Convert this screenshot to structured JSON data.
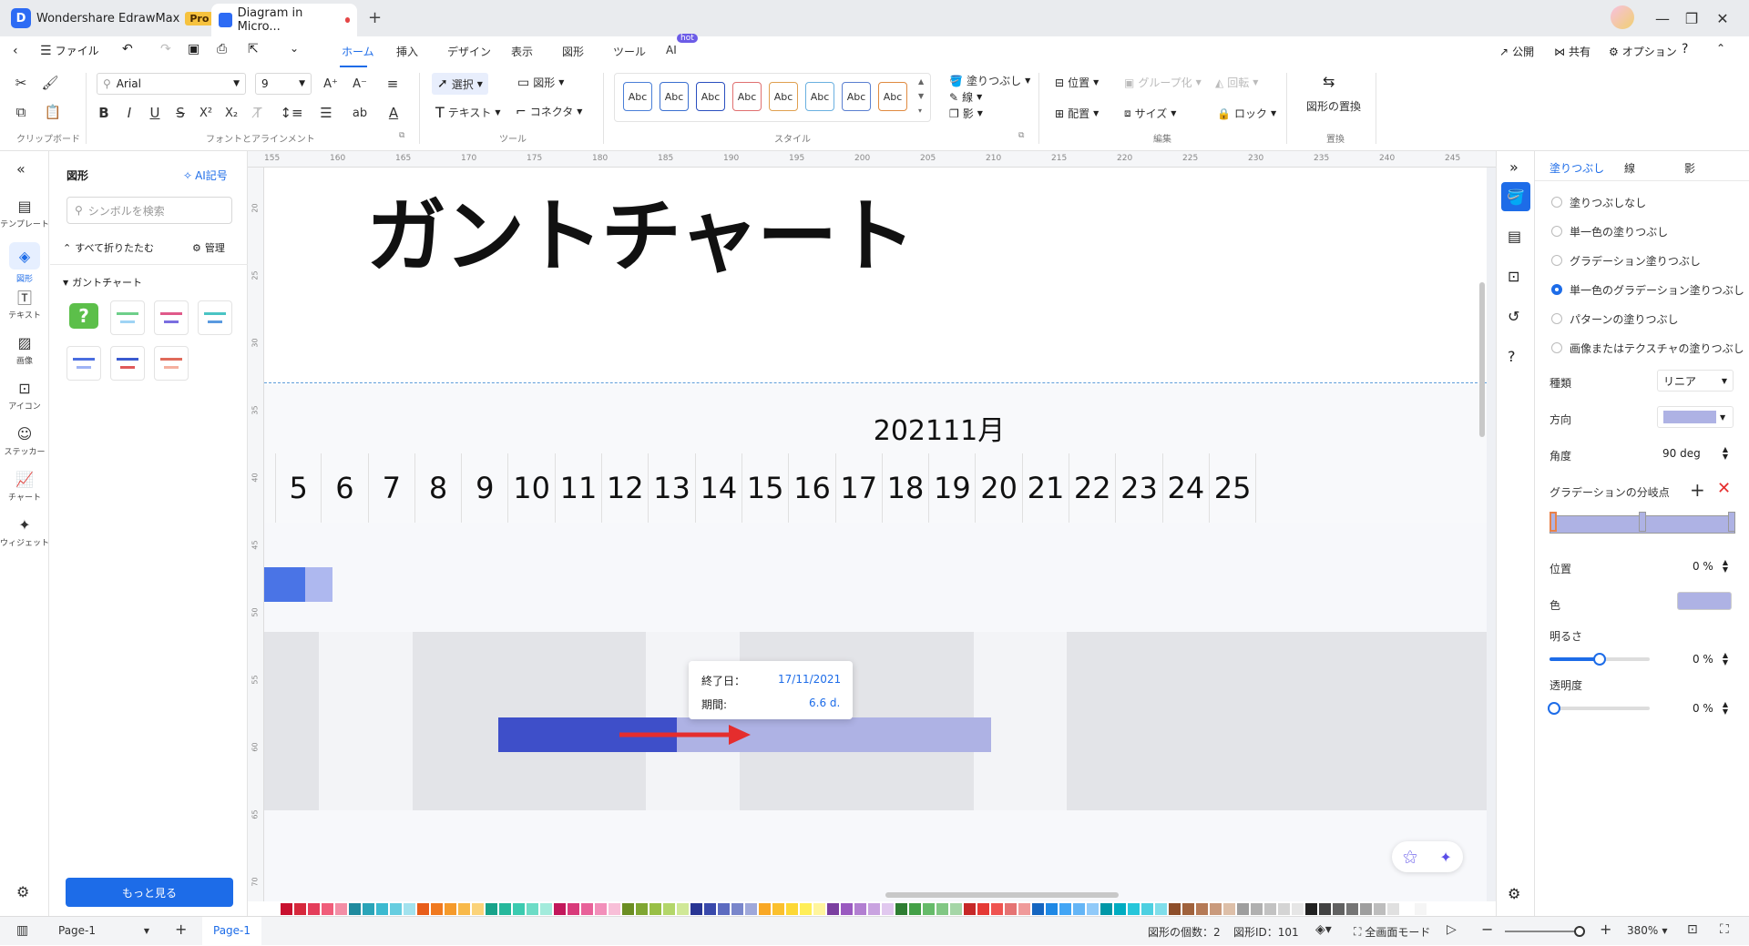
{
  "app": {
    "name": "Wondershare EdrawMax",
    "badge": "Pro",
    "doc_tab": "Diagram in Micro..."
  },
  "menu": {
    "file": "ファイル",
    "tabs": [
      "ホーム",
      "挿入",
      "デザイン",
      "表示",
      "図形",
      "ツール",
      "AI"
    ],
    "hot": "hot",
    "active": "ホーム",
    "right": [
      "公開",
      "共有",
      "オプション"
    ]
  },
  "ribbon": {
    "font": "Arial",
    "size": "9",
    "select": "選択",
    "shape": "図形",
    "text": "テキスト",
    "connector": "コネクタ",
    "fill": "塗りつぶし",
    "line": "線",
    "shadow": "影",
    "position": "位置",
    "align": "配置",
    "size_label": "サイズ",
    "group": "グループ化",
    "rotate": "回転",
    "lock": "ロック",
    "replace": "図形の置換",
    "style_sample": "Abc",
    "groups": [
      "クリップボード",
      "フォントとアラインメント",
      "ツール",
      "スタイル",
      "編集",
      "置換"
    ]
  },
  "leftbar": [
    "テンプレート",
    "図形",
    "テキスト",
    "画像",
    "アイコン",
    "ステッカー",
    "チャート",
    "ウィジェット"
  ],
  "shape_panel": {
    "title": "図形",
    "ai": "AI記号",
    "search_placeholder": "シンボルを検索",
    "collapse": "すべて折りたたむ",
    "manage": "管理",
    "category": "ガントチャート",
    "more": "もっと見る"
  },
  "ruler_top": [
    "155",
    "160",
    "165",
    "170",
    "175",
    "180",
    "185",
    "190",
    "195",
    "200",
    "205",
    "210",
    "215",
    "220",
    "225",
    "230",
    "235",
    "240",
    "245"
  ],
  "ruler_left": [
    "20",
    "25",
    "30",
    "35",
    "40",
    "45",
    "50",
    "55",
    "60",
    "65",
    "70"
  ],
  "chart_data": {
    "type": "table",
    "title": "ガントチャート",
    "month": "202111月",
    "days": [
      "5",
      "6",
      "7",
      "8",
      "9",
      "10",
      "11",
      "12",
      "13",
      "14",
      "15",
      "16",
      "17",
      "18",
      "19",
      "20",
      "21",
      "22",
      "23",
      "24",
      "25"
    ],
    "tooltip": {
      "end_label": "終了日：",
      "end_value": "17/11/2021",
      "duration_label": "期間:",
      "duration_value": "6.6 d."
    }
  },
  "right_panel": {
    "tabs": [
      "塗りつぶし",
      "線",
      "影"
    ],
    "options": [
      "塗りつぶしなし",
      "単一色の塗りつぶし",
      "グラデーション塗りつぶし",
      "単一色のグラデーション塗りつぶし",
      "パターンの塗りつぶし",
      "画像またはテクスチャの塗りつぶし"
    ],
    "selected_option": "単一色のグラデーション塗りつぶし",
    "kind_label": "種類",
    "kind_value": "リニア",
    "direction_label": "方向",
    "angle_label": "角度",
    "angle_value": "90 deg",
    "stops_label": "グラデーションの分岐点",
    "position_label": "位置",
    "position_value": "0 %",
    "color_label": "色",
    "color_value": "#aeb2e4",
    "brightness_label": "明るさ",
    "brightness_value": "0 %",
    "transparency_label": "透明度",
    "transparency_value": "0 %"
  },
  "status": {
    "page_menu": "Page-1",
    "page_tab": "Page-1",
    "shape_count": "図形の個数：2",
    "shape_id": "図形ID：101",
    "fullscreen": "全画面モード",
    "zoom": "380%"
  },
  "colors": {
    "accent": "#1d6ce8",
    "bar_dark": "#3e4fc9",
    "bar_light": "#aeb2e4",
    "arrow": "#e52d2d",
    "weekend": "#e2e3e7"
  }
}
